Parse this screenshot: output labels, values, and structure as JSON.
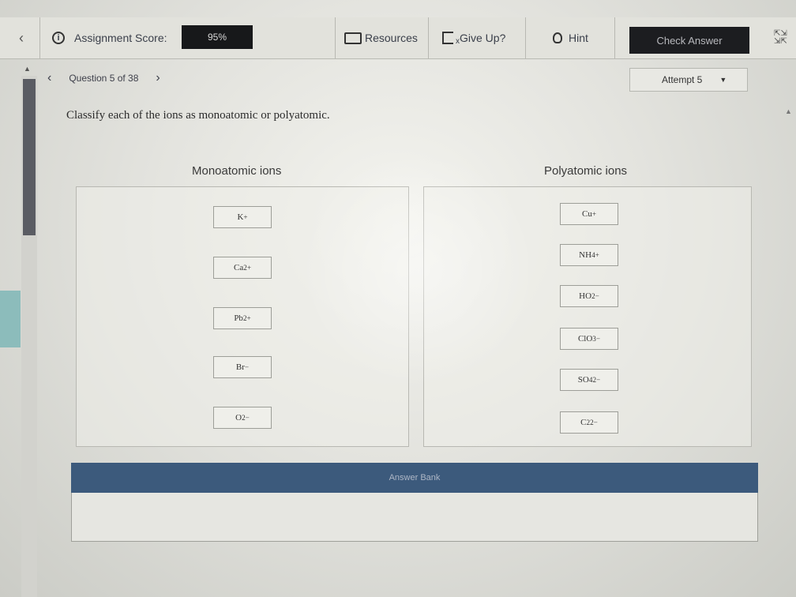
{
  "toolbar": {
    "assignment_score_label": "Assignment Score:",
    "assignment_score_value": "95%",
    "resources_label": "Resources",
    "give_up_label": "Give Up?",
    "hint_label": "Hint",
    "check_answer_label": "Check Answer"
  },
  "question_nav": {
    "label": "Question 5 of 38",
    "attempt_label": "Attempt 5"
  },
  "question": {
    "prompt": "Classify each of the ions as monoatomic or polyatomic."
  },
  "columns": {
    "monoatomic": {
      "heading": "Monoatomic ions",
      "chips": [
        {
          "base": "K",
          "sup": "+"
        },
        {
          "base": "Ca",
          "sup": "2+"
        },
        {
          "base": "Pb",
          "sup": "2+"
        },
        {
          "base": "Br",
          "sup": "−"
        },
        {
          "base": "O",
          "sup": "2−"
        }
      ]
    },
    "polyatomic": {
      "heading": "Polyatomic ions",
      "chips": [
        {
          "base": "Cu",
          "sup": "+"
        },
        {
          "base": "NH",
          "sub": "4",
          "sup": "+"
        },
        {
          "base": "HO",
          "sub": "2",
          "sup": "−"
        },
        {
          "base": "ClO",
          "sub": "3",
          "sup": "−"
        },
        {
          "base": "SO",
          "sub": "4",
          "sup": "2−"
        },
        {
          "base": "C",
          "sub": "2",
          "sup": "2−"
        }
      ]
    }
  },
  "answer_bank": {
    "title": "Answer Bank"
  },
  "icons": {
    "back": "chevron-left-icon",
    "info": "info-icon",
    "resources": "folder-icon",
    "give_up": "give-up-icon",
    "hint": "lightbulb-icon",
    "fullscreen": "expand-icon",
    "dropdown": "caret-down-icon"
  },
  "colors": {
    "score_box": "#17181a",
    "check_button": "#1c1d20",
    "answer_bank_header": "#3c5a7c",
    "scroll_thumb": "#5a5c63"
  }
}
